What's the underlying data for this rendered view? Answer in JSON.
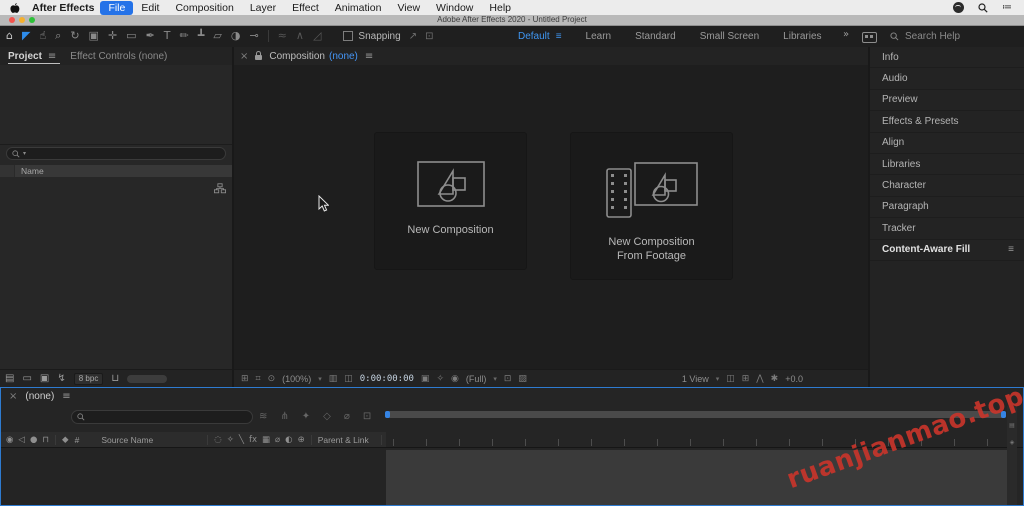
{
  "menu_bar": {
    "app_name": "After Effects",
    "items": [
      "File",
      "Edit",
      "Composition",
      "Layer",
      "Effect",
      "Animation",
      "View",
      "Window",
      "Help"
    ],
    "active_item": "File"
  },
  "title_bar": {
    "title": "Adobe After Effects 2020 - Untitled Project"
  },
  "toolbar": {
    "tools": [
      {
        "name": "home-icon",
        "glyph": "⌂",
        "color": "#c9c9c9"
      },
      {
        "name": "selection-tool",
        "glyph": "◤",
        "color": "#2e8ceb"
      },
      {
        "name": "hand-tool",
        "glyph": "☝",
        "color": "#a8a8a8"
      },
      {
        "name": "zoom-tool",
        "glyph": "⌕",
        "color": "#8f8f8f"
      },
      {
        "name": "rotate-tool",
        "glyph": "↻"
      },
      {
        "name": "camera-tool",
        "glyph": "▣"
      },
      {
        "name": "pan-behind-tool",
        "glyph": "✛"
      },
      {
        "name": "shape-tool",
        "glyph": "▭"
      },
      {
        "name": "pen-tool",
        "glyph": "✒"
      },
      {
        "name": "type-tool",
        "glyph": "T"
      },
      {
        "name": "brush-tool",
        "glyph": "✏"
      },
      {
        "name": "clone-stamp-tool",
        "glyph": "┻"
      },
      {
        "name": "eraser-tool",
        "glyph": "▱"
      },
      {
        "name": "roto-brush-tool",
        "glyph": "◑"
      },
      {
        "name": "puppet-pin-tool",
        "glyph": "⊸"
      },
      {
        "divider": true
      },
      {
        "name": "mask-feather-tool",
        "glyph": "≈",
        "dim": true
      },
      {
        "name": "vertex-tool",
        "glyph": "∧",
        "dim": true
      },
      {
        "name": "convert-vertex-tool",
        "glyph": "◿",
        "dim": true
      }
    ],
    "snapping_label": "Snapping",
    "snap_icons": [
      {
        "name": "snap-features-icon",
        "glyph": "↗"
      },
      {
        "name": "snap-grid-icon",
        "glyph": "⊡"
      }
    ],
    "workspaces": [
      "Default",
      "Learn",
      "Standard",
      "Small Screen",
      "Libraries"
    ],
    "active_workspace": "Default",
    "overflow": "»",
    "search_placeholder": "Search Help"
  },
  "project_panel": {
    "tabs": {
      "project": "Project",
      "effect_controls": "Effect Controls (none)"
    },
    "name_column": "Name",
    "footer_icons": [
      {
        "name": "interpret-footage-icon",
        "glyph": "▤"
      },
      {
        "name": "new-folder-icon",
        "glyph": "▭"
      },
      {
        "name": "new-composition-icon",
        "glyph": "▣"
      },
      {
        "name": "project-flowchart-icon",
        "glyph": "↯"
      }
    ],
    "bit_depth": "8 bpc"
  },
  "composition_panel": {
    "close": "×",
    "tab_label": "Composition",
    "tab_value": "(none)",
    "new_comp_label": "New Composition",
    "new_footage_line1": "New Composition",
    "new_footage_line2": "From Footage",
    "statusbar": {
      "left_icons": [
        {
          "name": "always-preview-icon",
          "glyph": "⊞"
        },
        {
          "name": "main-viewer-icon",
          "glyph": "⌗"
        },
        {
          "name": "magnification-icon",
          "glyph": "⊙"
        }
      ],
      "zoom": "(100%)",
      "mid_icons": [
        {
          "name": "safe-guides-icon",
          "glyph": "▥"
        },
        {
          "name": "mask-visibility-icon",
          "glyph": "◫"
        }
      ],
      "timecode": "0:00:00:00",
      "tc_icons": [
        {
          "name": "snapshot-icon",
          "glyph": "▣"
        },
        {
          "name": "show-snapshot-icon",
          "glyph": "✧"
        },
        {
          "name": "show-channel-icon",
          "glyph": "◉"
        }
      ],
      "resolution": "(Full)",
      "res_icons": [
        {
          "name": "region-of-interest-icon",
          "glyph": "⊡"
        },
        {
          "name": "transparency-grid-icon",
          "glyph": "▨"
        }
      ],
      "view_layout": "1 View",
      "right_icons": [
        {
          "name": "shared-view-icon",
          "glyph": "◫"
        },
        {
          "name": "pixel-aspect-icon",
          "glyph": "⊞"
        },
        {
          "name": "fast-previews-icon",
          "glyph": "⋀"
        },
        {
          "name": "camera-settings-icon",
          "glyph": "✱"
        }
      ],
      "exposure": "+0.0"
    }
  },
  "right_sidebar": {
    "items": [
      "Info",
      "Audio",
      "Preview",
      "Effects & Presets",
      "Align",
      "Libraries",
      "Character",
      "Paragraph",
      "Tracker",
      "Content-Aware Fill"
    ],
    "active_item": "Content-Aware Fill"
  },
  "timeline_panel": {
    "close": "×",
    "tab": "(none)",
    "toggles": [
      {
        "name": "composition-mini-flowchart-icon",
        "glyph": "≋"
      },
      {
        "name": "draft-3d-icon",
        "glyph": "⋔"
      },
      {
        "name": "hide-shy-layers-icon",
        "glyph": "✦"
      },
      {
        "name": "frame-blending-icon",
        "glyph": "◇"
      },
      {
        "name": "motion-blur-icon",
        "glyph": "⌀"
      },
      {
        "name": "graph-editor-icon",
        "glyph": "⊡"
      }
    ],
    "av_toggles": [
      {
        "name": "video-eye-icon",
        "glyph": "◉"
      },
      {
        "name": "audio-icon",
        "glyph": "◁"
      },
      {
        "name": "solo-icon",
        "glyph": "●"
      },
      {
        "name": "lock-icon",
        "glyph": "⊓"
      }
    ],
    "label_icon": "◆",
    "number_column": "#",
    "source_name_column": "Source Name",
    "switch_icons": [
      {
        "name": "shy-icon",
        "glyph": "◌"
      },
      {
        "name": "collapse-icon",
        "glyph": "✧"
      },
      {
        "name": "quality-icon",
        "glyph": "╲"
      },
      {
        "name": "fx-icon",
        "glyph": "fx"
      },
      {
        "name": "adjustment-icon",
        "glyph": "▦"
      },
      {
        "name": "motion-blur-switch-icon",
        "glyph": "⌀"
      },
      {
        "name": "blend-icon",
        "glyph": "◐"
      },
      {
        "name": "3d-layer-icon",
        "glyph": "⊕"
      }
    ],
    "parent_link_column": "Parent & Link"
  },
  "watermark": {
    "text": "ruanjianmao.top",
    "color": "#cf352b"
  },
  "colors": {
    "accent_blue": "#2e8ceb",
    "menu_highlight": "#2472e8",
    "workspace_active": "#3f96f2",
    "panel_bg": "#232323",
    "viewer_bg": "#1e1e1e",
    "watermark_red": "#cf352b",
    "timeline_focus_border": "#2e7bd0"
  }
}
